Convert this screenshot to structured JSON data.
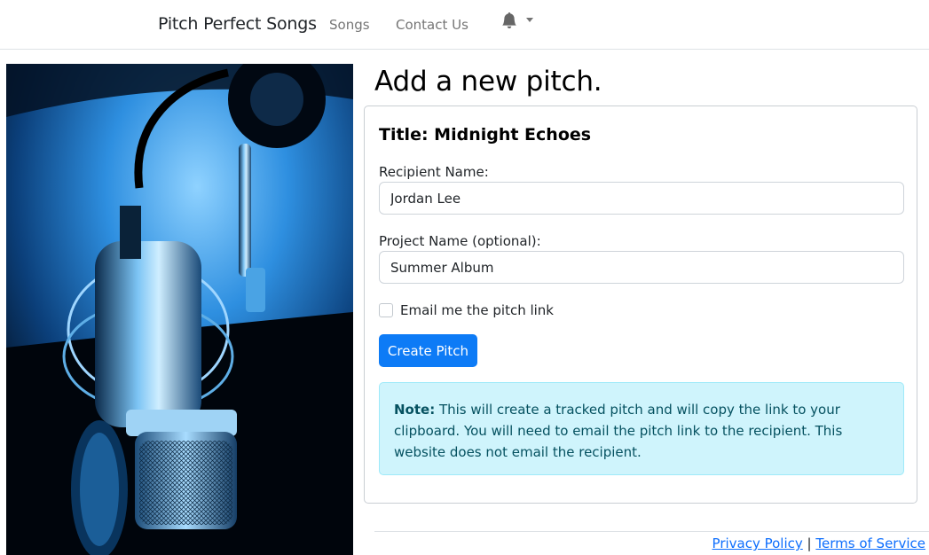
{
  "navbar": {
    "brand": "Pitch Perfect Songs",
    "links": [
      {
        "label": "Songs"
      },
      {
        "label": "Contact Us"
      }
    ],
    "notification_icon": "bell-icon"
  },
  "page": {
    "title": "Add a new pitch."
  },
  "form": {
    "card_title": "Title: Midnight Echoes",
    "recipient_label": "Recipient Name:",
    "recipient_value": "Jordan Lee",
    "project_label": "Project Name (optional):",
    "project_value": "Summer Album",
    "email_checkbox_label": "Email me the pitch link",
    "email_checkbox_checked": false,
    "submit_label": "Create Pitch"
  },
  "note": {
    "label": "Note:",
    "text": " This will create a tracked pitch and will copy the link to your clipboard. You will need to email the pitch link to the recipient. This website does not email the recipient."
  },
  "footer": {
    "privacy_label": "Privacy Policy",
    "separator": "|",
    "terms_label": "Terms of Service"
  },
  "colors": {
    "primary": "#0d7bf6",
    "alert_bg": "#cff4fc",
    "alert_text": "#055160",
    "link": "#0d6efd"
  }
}
